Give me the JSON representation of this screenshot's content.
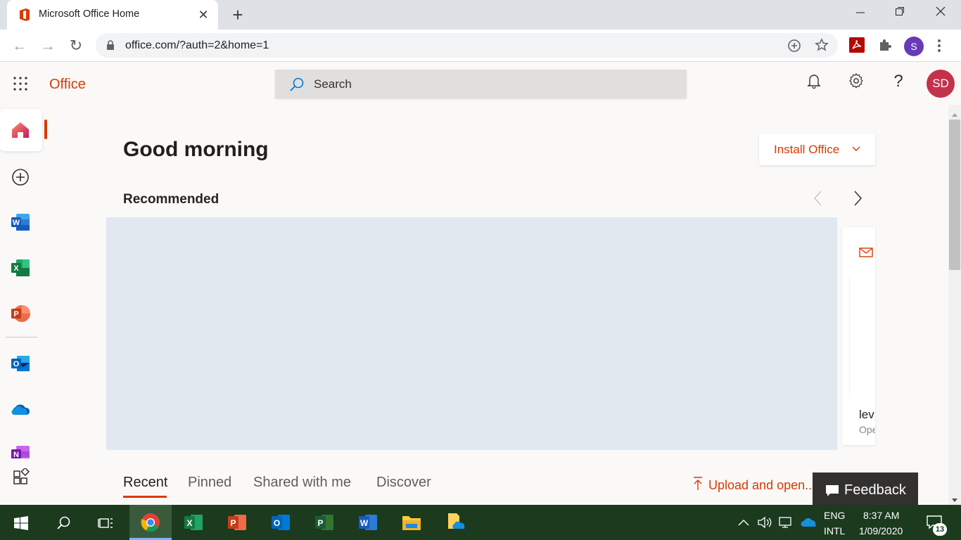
{
  "browser": {
    "tab_title": "Microsoft Office Home",
    "url": "office.com/?auth=2&home=1",
    "profile_initial": "S"
  },
  "header": {
    "brand": "Office",
    "search_placeholder": "Search",
    "avatar_initials": "SD"
  },
  "main": {
    "greeting": "Good morning",
    "install_label": "Install Office",
    "recommended_title": "Recommended",
    "peek_title": "lev",
    "peek_subtitle": "Ope",
    "tabs": [
      "Recent",
      "Pinned",
      "Shared with me",
      "Discover"
    ],
    "upload_label": "Upload and open...",
    "feedback_label": "Feedback"
  },
  "taskbar": {
    "lang": "ENG",
    "layout": "INTL",
    "time": "8:37 AM",
    "date": "1/09/2020",
    "notifications": "13"
  },
  "colors": {
    "accent": "#d83b01",
    "avatar": "#c4314b",
    "banner": "#e1e8ef",
    "taskbar": "#1b3a1e"
  }
}
